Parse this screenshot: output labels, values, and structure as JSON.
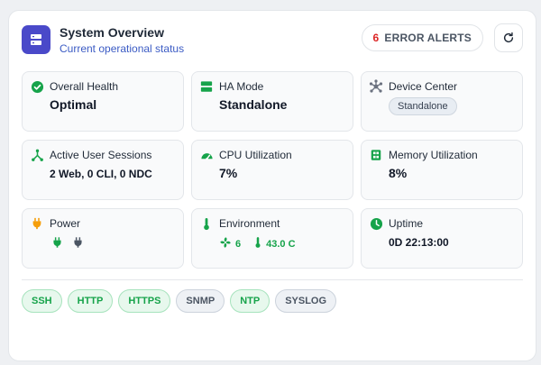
{
  "header": {
    "title": "System Overview",
    "subtitle": "Current operational status",
    "alert_count": "6",
    "alert_label": "ERROR ALERTS",
    "refresh_icon": "refresh-icon"
  },
  "tiles": {
    "overall_health": {
      "label": "Overall Health",
      "value": "Optimal",
      "icon": "check-circle-icon"
    },
    "ha_mode": {
      "label": "HA Mode",
      "value": "Standalone",
      "icon": "server-icon"
    },
    "device_center": {
      "label": "Device Center",
      "value": "Standalone",
      "icon": "network-hub-icon"
    },
    "sessions": {
      "label": "Active User Sessions",
      "value": "2 Web, 0 CLI, 0 NDC",
      "icon": "users-branch-icon"
    },
    "cpu": {
      "label": "CPU Utilization",
      "value": "7%",
      "icon": "gauge-icon"
    },
    "memory": {
      "label": "Memory Utilization",
      "value": "8%",
      "icon": "memory-chip-icon"
    },
    "power": {
      "label": "Power",
      "icon": "plug-icon"
    },
    "environment": {
      "label": "Environment",
      "fan_count": "6",
      "temperature": "43.0 C",
      "icon": "thermometer-icon"
    },
    "uptime": {
      "label": "Uptime",
      "value": "0D 22:13:00",
      "icon": "clock-icon"
    }
  },
  "protocols": [
    {
      "label": "SSH",
      "enabled": true
    },
    {
      "label": "HTTP",
      "enabled": true
    },
    {
      "label": "HTTPS",
      "enabled": true
    },
    {
      "label": "SNMP",
      "enabled": false
    },
    {
      "label": "NTP",
      "enabled": true
    },
    {
      "label": "SYSLOG",
      "enabled": false
    }
  ],
  "colors": {
    "accent": "#4a49c9",
    "ok": "#16a34a",
    "alert": "#dc2626",
    "warn": "#f59e0b"
  }
}
